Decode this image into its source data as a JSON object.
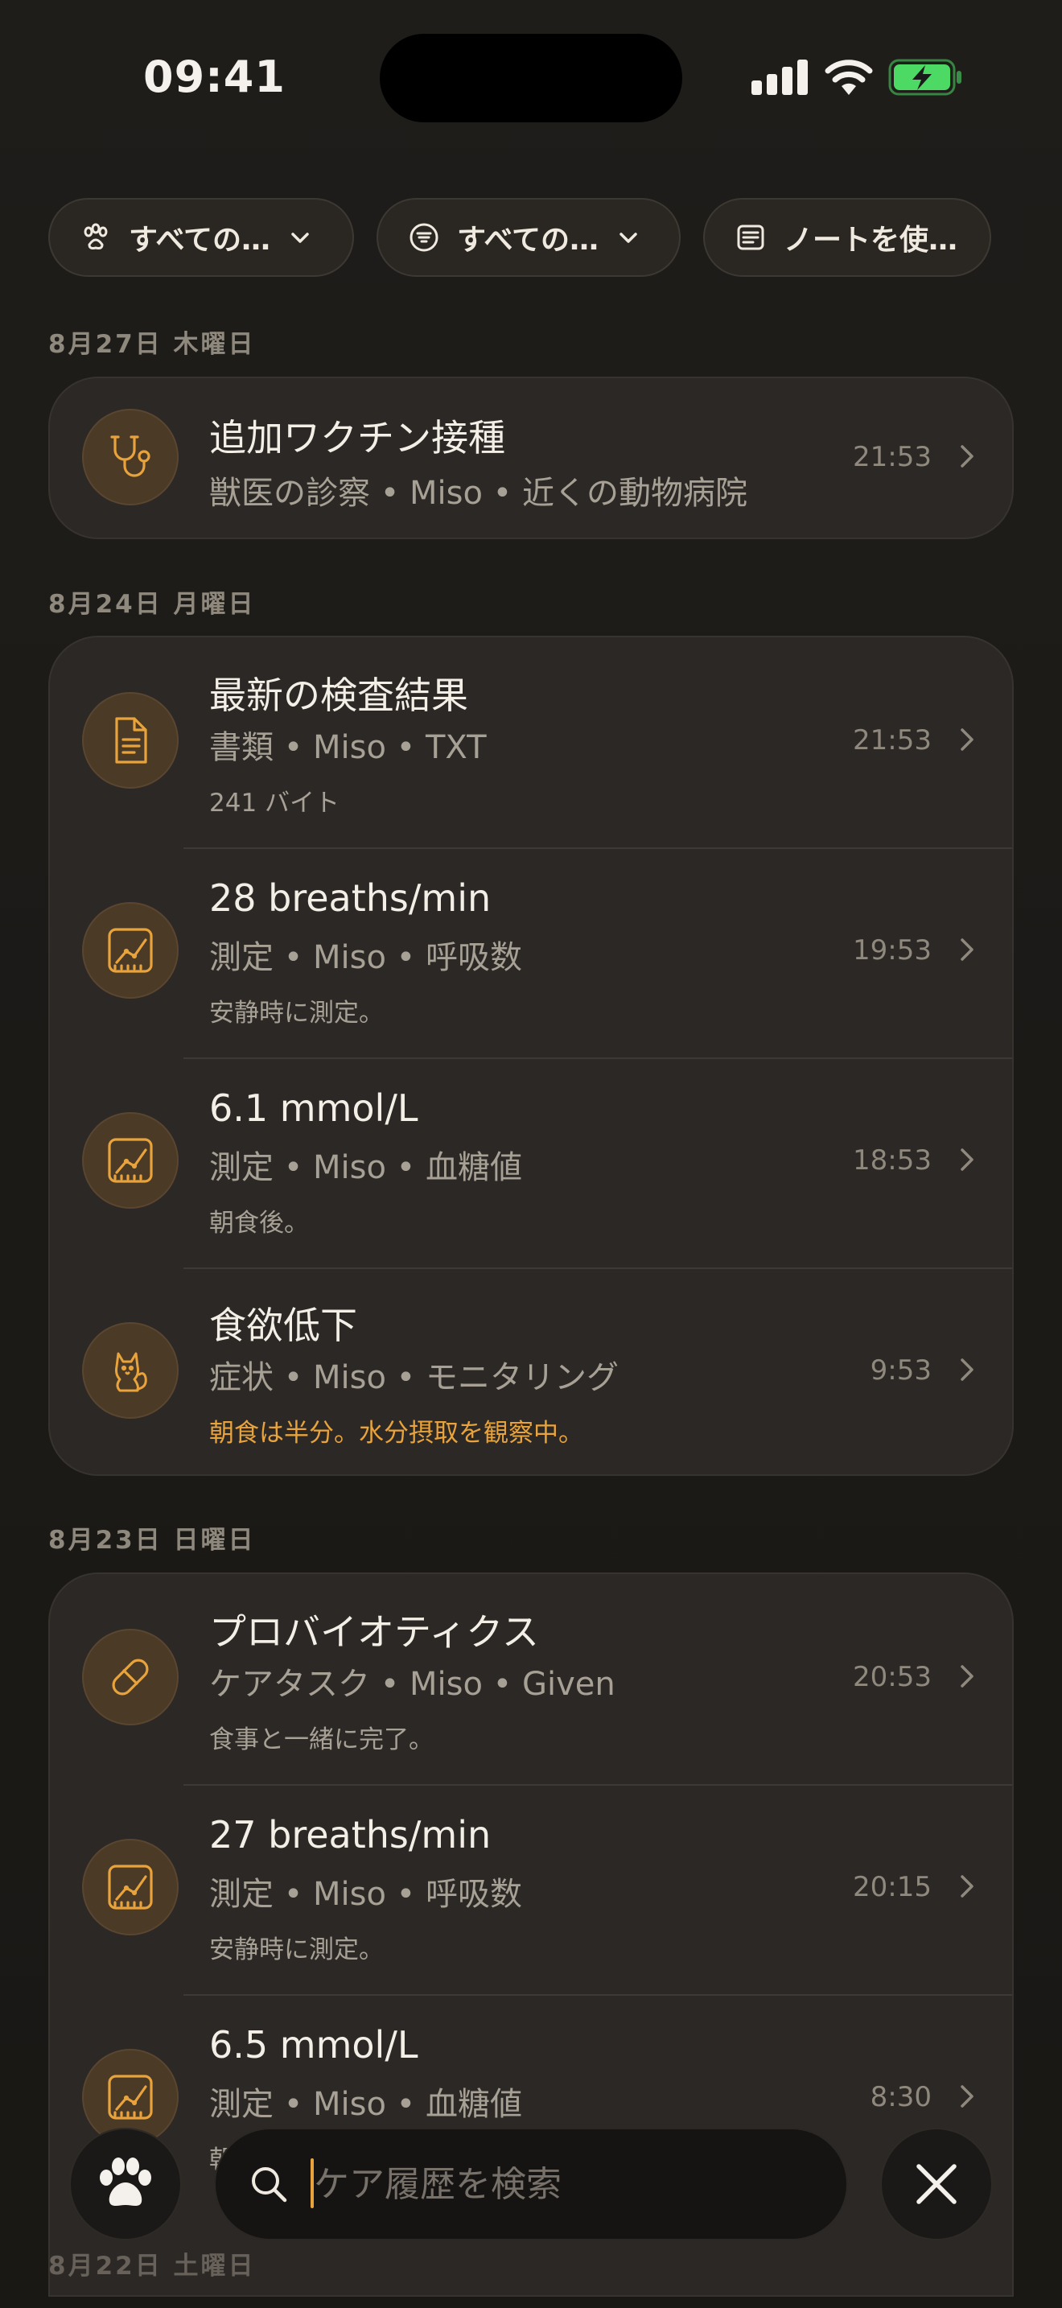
{
  "status_bar": {
    "time": "09:41"
  },
  "filters": [
    {
      "label": "すべての…",
      "icon": "paw-icon"
    },
    {
      "label": "すべての…",
      "icon": "filter-icon"
    },
    {
      "label": "ノートを使…",
      "icon": "note-icon"
    }
  ],
  "sections": [
    {
      "date": "8月27日 木曜日",
      "entries": [
        {
          "title": "追加ワクチン接種",
          "subtitle": "獣医の診察 • Miso • 近くの動物病院",
          "note": "",
          "time": "21:53",
          "icon": "stethoscope-icon"
        }
      ]
    },
    {
      "date": "8月24日 月曜日",
      "entries": [
        {
          "title": "最新の検査結果",
          "subtitle": "書類 • Miso • TXT",
          "note": "241 バイト",
          "time": "21:53",
          "icon": "document-icon"
        },
        {
          "title": "28 breaths/min",
          "subtitle": "測定 • Miso • 呼吸数",
          "note": "安静時に測定。",
          "time": "19:53",
          "icon": "chart-icon"
        },
        {
          "title": "6.1 mmol/L",
          "subtitle": "測定 • Miso • 血糖値",
          "note": "朝食後。",
          "time": "18:53",
          "icon": "chart-icon"
        },
        {
          "title": "食欲低下",
          "subtitle": "症状 • Miso • モニタリング",
          "note": "朝食は半分。水分摂取を観察中。",
          "time": "9:53",
          "icon": "cat-icon"
        }
      ]
    },
    {
      "date": "8月23日 日曜日",
      "entries": [
        {
          "title": "プロバイオティクス",
          "subtitle": "ケアタスク • Miso • Given",
          "note": "食事と一緒に完了。",
          "time": "20:53",
          "icon": "pill-icon"
        },
        {
          "title": "27 breaths/min",
          "subtitle": "測定 • Miso • 呼吸数",
          "note": "安静時に測定。",
          "time": "20:15",
          "icon": "chart-icon"
        },
        {
          "title": "6.5 mmol/L",
          "subtitle": "測定 • Miso • 血糖値",
          "note": "朝",
          "time": "8:30",
          "icon": "chart-icon"
        }
      ]
    },
    {
      "date": "8月22日 土曜日"
    }
  ],
  "search": {
    "placeholder": "ケア履歴を検索"
  },
  "colors": {
    "accent": "#e8a33c",
    "card": "#2b2825",
    "background": "#1f1d1a",
    "battery": "#4cd964"
  }
}
